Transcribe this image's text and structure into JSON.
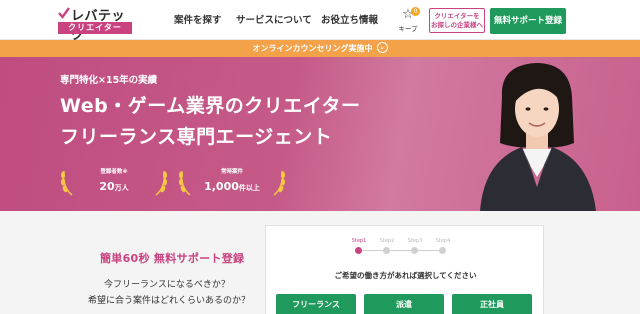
{
  "brand": {
    "name": "レバテック",
    "sub": "クリエイター",
    "accent": "#c8437f",
    "green": "#1f9a5c",
    "orange": "#f3a24a"
  },
  "nav": {
    "items": [
      "案件を探す",
      "サービスについて",
      "お役立ち情報"
    ],
    "keep_label": "キープ",
    "keep_count": "0",
    "company_button": "クリエイターを\nお探しの企業様へ",
    "register_button": "無料サポート登録"
  },
  "banner": {
    "text": "オンラインカウンセリング実施中",
    "icon": "chevron-down-icon"
  },
  "hero": {
    "subtitle": "専門特化×15年の実績",
    "title_line1": "Web・ゲーム業界のクリエイター",
    "title_line2": "フリーランス専門エージェント",
    "stats": [
      {
        "label": "登録者数",
        "note": "※",
        "value": "20",
        "unit": "万人"
      },
      {
        "label": "常時案件",
        "note": "",
        "value": "1,000",
        "unit": "件以上"
      }
    ]
  },
  "cta": {
    "title": "簡単60秒 無料サポート登録",
    "question1": "今フリーランスになるべきか？",
    "question2": "希望に合う案件はどれくらいあるのか？"
  },
  "form": {
    "steps": [
      "Step1",
      "Step2",
      "Step3",
      "Step4"
    ],
    "active_step": 1,
    "question": "ご希望の働き方があれば選択してください",
    "options": [
      "フリーランス",
      "派遣",
      "正社員"
    ]
  }
}
